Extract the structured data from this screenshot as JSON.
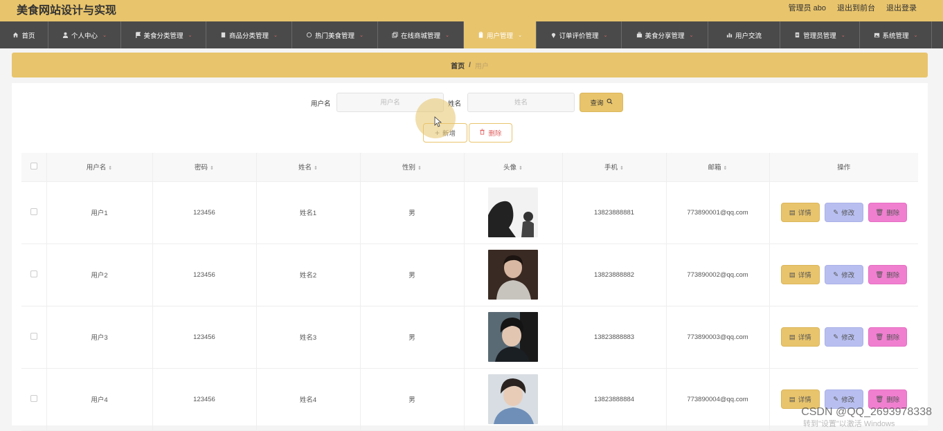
{
  "header": {
    "title": "美食网站设计与实现",
    "admin": "管理员 abo",
    "back_front": "退出到前台",
    "logout": "退出登录"
  },
  "nav": [
    {
      "label": "首页",
      "icon": "home-icon",
      "has_arrow": false
    },
    {
      "label": "个人中心",
      "icon": "user-icon",
      "has_arrow": true
    },
    {
      "label": "美食分类管理",
      "icon": "flag-icon",
      "has_arrow": true
    },
    {
      "label": "商品分类管理",
      "icon": "book-icon",
      "has_arrow": true
    },
    {
      "label": "热门美食管理",
      "icon": "circle-icon",
      "has_arrow": true
    },
    {
      "label": "在线商城管理",
      "icon": "copy-icon",
      "has_arrow": true
    },
    {
      "label": "用户管理",
      "icon": "clipboard-icon",
      "has_arrow": true,
      "active": true
    },
    {
      "label": "订单评价管理",
      "icon": "location-icon",
      "has_arrow": true
    },
    {
      "label": "美食分享管理",
      "icon": "briefcase-icon",
      "has_arrow": true
    },
    {
      "label": "用户交流",
      "icon": "chart-icon",
      "has_arrow": false
    },
    {
      "label": "管理员管理",
      "icon": "document-icon",
      "has_arrow": true
    },
    {
      "label": "系统管理",
      "icon": "image-icon",
      "has_arrow": true
    }
  ],
  "breadcrumb": {
    "home": "首页",
    "sep": "/",
    "current": "用户"
  },
  "search": {
    "username_label": "用户名",
    "username_placeholder": "用户名",
    "name_label": "姓名",
    "name_placeholder": "姓名",
    "query_label": "查询"
  },
  "actions": {
    "add_label": "新增",
    "delete_label": "删除"
  },
  "table": {
    "columns": [
      "用户名",
      "密码",
      "姓名",
      "性别",
      "头像",
      "手机",
      "邮箱",
      "操作"
    ],
    "rows": [
      {
        "username": "用户1",
        "password": "123456",
        "name": "姓名1",
        "gender": "男",
        "phone": "13823888881",
        "email": "773890001@qq.com"
      },
      {
        "username": "用户2",
        "password": "123456",
        "name": "姓名2",
        "gender": "男",
        "phone": "13823888882",
        "email": "773890002@qq.com"
      },
      {
        "username": "用户3",
        "password": "123456",
        "name": "姓名3",
        "gender": "男",
        "phone": "13823888883",
        "email": "773890003@qq.com"
      },
      {
        "username": "用户4",
        "password": "123456",
        "name": "姓名4",
        "gender": "男",
        "phone": "13823888884",
        "email": "773890004@qq.com"
      }
    ],
    "ops": {
      "detail": "详情",
      "edit": "修改",
      "delete": "删除"
    }
  },
  "watermark": "CSDN @QQ_2693978338",
  "win_watermark": "转到\"设置\"以激活 Windows",
  "colors": {
    "accent": "#e8c46c",
    "nav_bg": "#4a4a4a",
    "edit": "#b8bff0",
    "delete": "#f07fd0"
  }
}
